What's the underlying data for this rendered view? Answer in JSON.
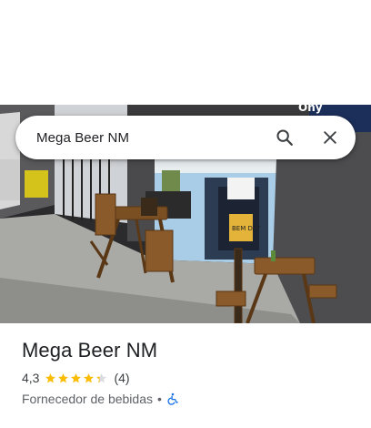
{
  "search": {
    "query": "Mega Beer NM",
    "search_icon": "search-icon",
    "close_icon": "close-icon"
  },
  "photo": {
    "description_icon": "place-photo",
    "sign_fragment": "Ony",
    "poster_text": "BEM DAY"
  },
  "place": {
    "name": "Mega Beer NM",
    "rating": "4,3",
    "rating_stars": 4.3,
    "review_count": "(4)",
    "category": "Fornecedor de bebidas",
    "separator": "•",
    "accessibility_icon": "wheelchair-icon"
  },
  "colors": {
    "star": "#fbbc04",
    "star_empty": "#dadce0",
    "accessibility_blue": "#1a73e8",
    "title": "#202124",
    "secondary": "#5f6368"
  }
}
